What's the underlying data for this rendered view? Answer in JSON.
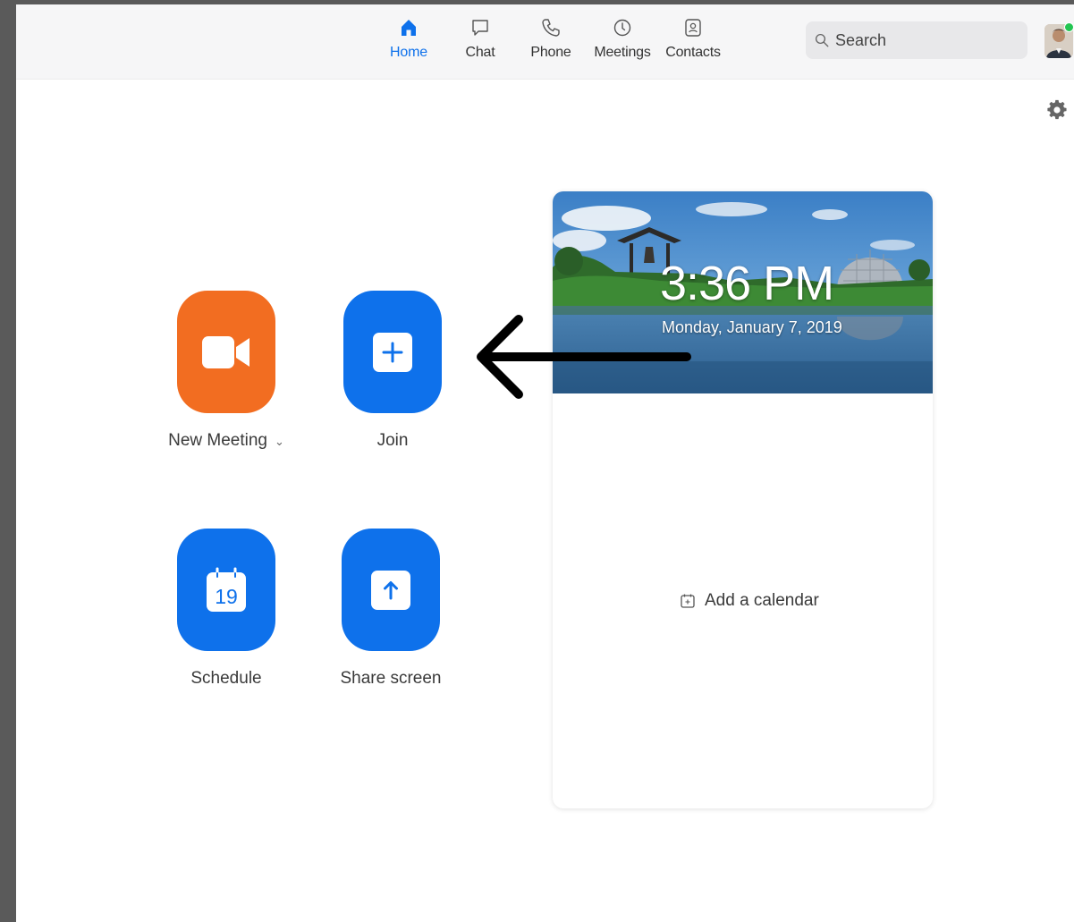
{
  "nav": {
    "tabs": [
      {
        "label": "Home",
        "icon": "home-icon",
        "active": true
      },
      {
        "label": "Chat",
        "icon": "chat-icon",
        "active": false
      },
      {
        "label": "Phone",
        "icon": "phone-icon",
        "active": false
      },
      {
        "label": "Meetings",
        "icon": "clock-icon",
        "active": false
      },
      {
        "label": "Contacts",
        "icon": "contacts-icon",
        "active": false
      }
    ]
  },
  "search": {
    "placeholder": "Search"
  },
  "profile": {
    "status_color": "#23c552"
  },
  "actions": {
    "new_meeting": {
      "label": "New Meeting",
      "color": "#f26d21"
    },
    "join": {
      "label": "Join",
      "color": "#0e71eb"
    },
    "schedule": {
      "label": "Schedule",
      "calendar_day": "19",
      "color": "#0e71eb"
    },
    "share_screen": {
      "label": "Share screen",
      "color": "#0e71eb"
    }
  },
  "calendar_card": {
    "time": "3:36 PM",
    "date": "Monday, January 7, 2019",
    "add_calendar_label": "Add a calendar"
  },
  "colors": {
    "accent": "#0e71eb",
    "orange": "#f26d21"
  }
}
